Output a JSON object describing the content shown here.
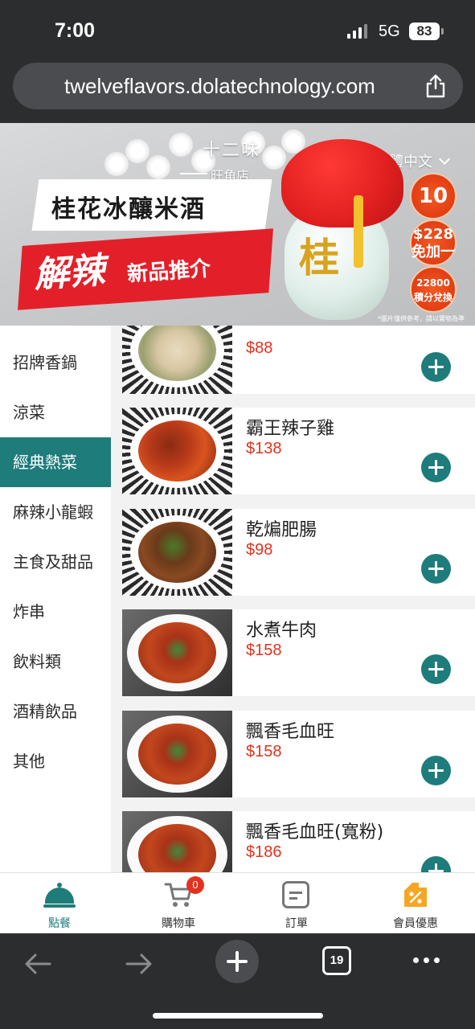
{
  "status": {
    "time": "7:00",
    "network": "5G",
    "battery": "83"
  },
  "browser": {
    "url": "twelveflavors.dolatechnology.com",
    "tab_count": "19"
  },
  "banner": {
    "store_name": "十二味",
    "store_branch": "旺角店",
    "language": "繁體中文",
    "headline": "桂花冰釀米酒",
    "sub_big": "解辣",
    "sub_small": "新品推介",
    "jar_mark": "桂",
    "badges": [
      "10",
      "$228\n免加一",
      "22800\n積分兌換"
    ],
    "disclaimer": "*圖片僅供參考，請以實物為準"
  },
  "categories": [
    {
      "label": "招牌香鍋",
      "active": false
    },
    {
      "label": "涼菜",
      "active": false
    },
    {
      "label": "經典熱菜",
      "active": true
    },
    {
      "label": "麻辣小龍蝦",
      "active": false
    },
    {
      "label": "主食及甜品",
      "active": false
    },
    {
      "label": "炸串",
      "active": false
    },
    {
      "label": "飲料類",
      "active": false
    },
    {
      "label": "酒精飲品",
      "active": false
    },
    {
      "label": "其他",
      "active": false
    }
  ],
  "items": [
    {
      "name": "",
      "price": "$88"
    },
    {
      "name": "霸王辣子雞",
      "price": "$138"
    },
    {
      "name": "乾煸肥腸",
      "price": "$98"
    },
    {
      "name": "水煮牛肉",
      "price": "$158"
    },
    {
      "name": "飄香毛血旺",
      "price": "$158"
    },
    {
      "name": "飄香毛血旺(寬粉)",
      "price": "$186"
    }
  ],
  "tabbar": {
    "order_food": "點餐",
    "cart": "購物車",
    "cart_count": "0",
    "orders": "訂單",
    "member": "會員優惠"
  },
  "colors": {
    "accent": "#1e7c7b",
    "price": "#e2321e",
    "badge": "#e2321e"
  },
  "icons": [
    "share-icon",
    "chevron-down-icon",
    "plus-icon",
    "cloche-icon",
    "cart-icon",
    "order-icon",
    "member-discount-icon",
    "back-arrow-icon",
    "forward-arrow-icon",
    "new-tab-icon",
    "tabs-icon",
    "more-icon"
  ]
}
